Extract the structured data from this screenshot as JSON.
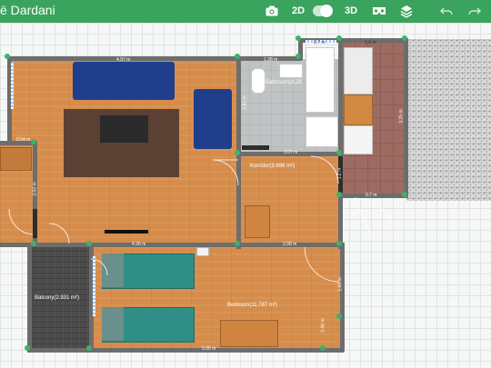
{
  "header": {
    "title": "ë Dardani",
    "view_2d_label": "2D",
    "view_3d_label": "3D",
    "toggle_state": "2D",
    "icons": [
      "camera-icon",
      "vr-headset-icon",
      "layers-icon",
      "undo-icon",
      "redo-icon"
    ]
  },
  "colors": {
    "brand": "#3aa35d",
    "wall": "#6d6d6d",
    "floor": "#d68d4c",
    "node": "#3cb26b"
  },
  "plan": {
    "dimensions": {
      "living_top": "4.97 m",
      "bath_top": "1.38 m",
      "bath_right_top": "0.7 m",
      "pantry_top": "1.4 m",
      "bath_bottom": "3.07 m",
      "living_bottom": "4.36 m",
      "corridor_bottom": "2.08 m",
      "bedroom_bottom": "5.05 m",
      "bath_height": "1.82 m",
      "pantry_height": "3.25 m",
      "left_top": "0.54 m",
      "left_side": "2.03 m",
      "corridor_side": "1.2 m",
      "bedroom_side": "1.64 m",
      "bedroom_bottom_side": "0.46 m",
      "pantry_bottom": "0.7 m"
    },
    "rooms": {
      "bathroom": "Bathroom(4.28",
      "corridor": "Korridor(3.896 m²)",
      "balcony": "Balcony(2.931 m²)",
      "bedroom": "Bedroom(11.787 m²)"
    }
  }
}
